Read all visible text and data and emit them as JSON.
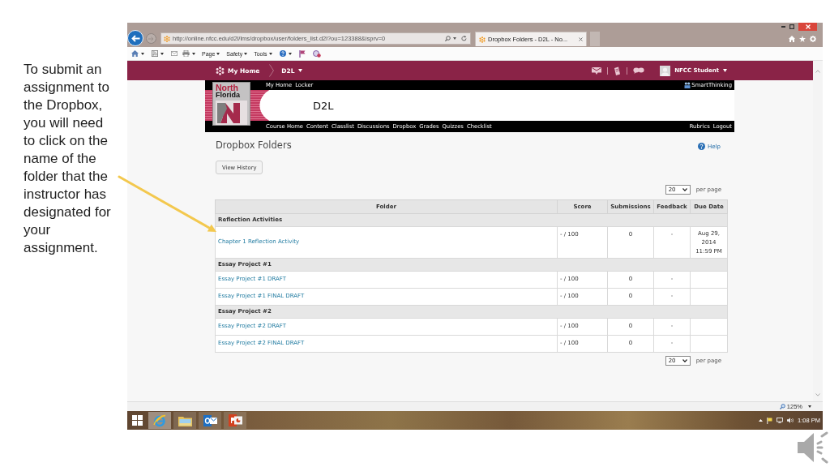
{
  "slide": {
    "caption": "To submit an assignment to the Dropbox, you will need to click on the name of the folder that the instructor has designated for your assignment."
  },
  "browser": {
    "address": "http://online.nfcc.edu/d2l/lms/dropbox/user/folders_list.d2l?ou=123388&isprv=0",
    "tab": {
      "title": "Dropbox Folders - D2L - No..."
    },
    "command_bar": [
      "Page",
      "Safety",
      "Tools"
    ],
    "zoom": "125%"
  },
  "d2l": {
    "minibar": {
      "home": "My Home",
      "course": "D2L",
      "user": "NFCC Student"
    },
    "top_links": [
      "My Home",
      "Locker"
    ],
    "smartthinking": "SmartThinking",
    "logo": [
      "North",
      "Florida"
    ],
    "course_title": "D2L",
    "course_nav": [
      "Course Home",
      "Content",
      "Classlist",
      "Discussions",
      "Dropbox",
      "Grades",
      "Quizzes",
      "Checklist"
    ],
    "right_links": [
      "Rubrics",
      "Logout"
    ]
  },
  "page": {
    "title": "Dropbox Folders",
    "help": "Help",
    "history_button": "View History",
    "pager_top": {
      "value": "20",
      "label": "per page"
    },
    "table": {
      "columns": [
        "Folder",
        "Score",
        "Submissions",
        "Feedback",
        "Due Date"
      ],
      "rows": [
        {
          "kind": "category",
          "name": "Reflection Activities"
        },
        {
          "kind": "folder",
          "name": "Chapter 1 Reflection Activity",
          "score": "- / 100",
          "submissions": "0",
          "feedback": "-",
          "due_date": "Aug 29, 2014 11:59 PM"
        },
        {
          "kind": "category",
          "name": "Essay Project #1"
        },
        {
          "kind": "folder",
          "name": "Essay Project #1 DRAFT",
          "score": "- / 100",
          "submissions": "0",
          "feedback": "-"
        },
        {
          "kind": "folder",
          "name": "Essay Project #1 FINAL DRAFT",
          "score": "- / 100",
          "submissions": "0",
          "feedback": "-"
        },
        {
          "kind": "category",
          "name": "Essay Project #2"
        },
        {
          "kind": "folder",
          "name": "Essay Project #2 DRAFT",
          "score": "- / 100",
          "submissions": "0",
          "feedback": "-"
        },
        {
          "kind": "folder",
          "name": "Essay Project #2 FINAL DRAFT",
          "score": "- / 100",
          "submissions": "0",
          "feedback": "-"
        }
      ]
    },
    "pager_bottom": {
      "value": "20",
      "label": "per page"
    }
  },
  "taskbar": {
    "apps": [
      {
        "kind": "browser",
        "selected": true
      },
      {
        "kind": "files",
        "selected": false
      },
      {
        "kind": "mail",
        "selected": false
      },
      {
        "kind": "slides",
        "selected": false
      }
    ],
    "clock": "1:08 PM"
  }
}
